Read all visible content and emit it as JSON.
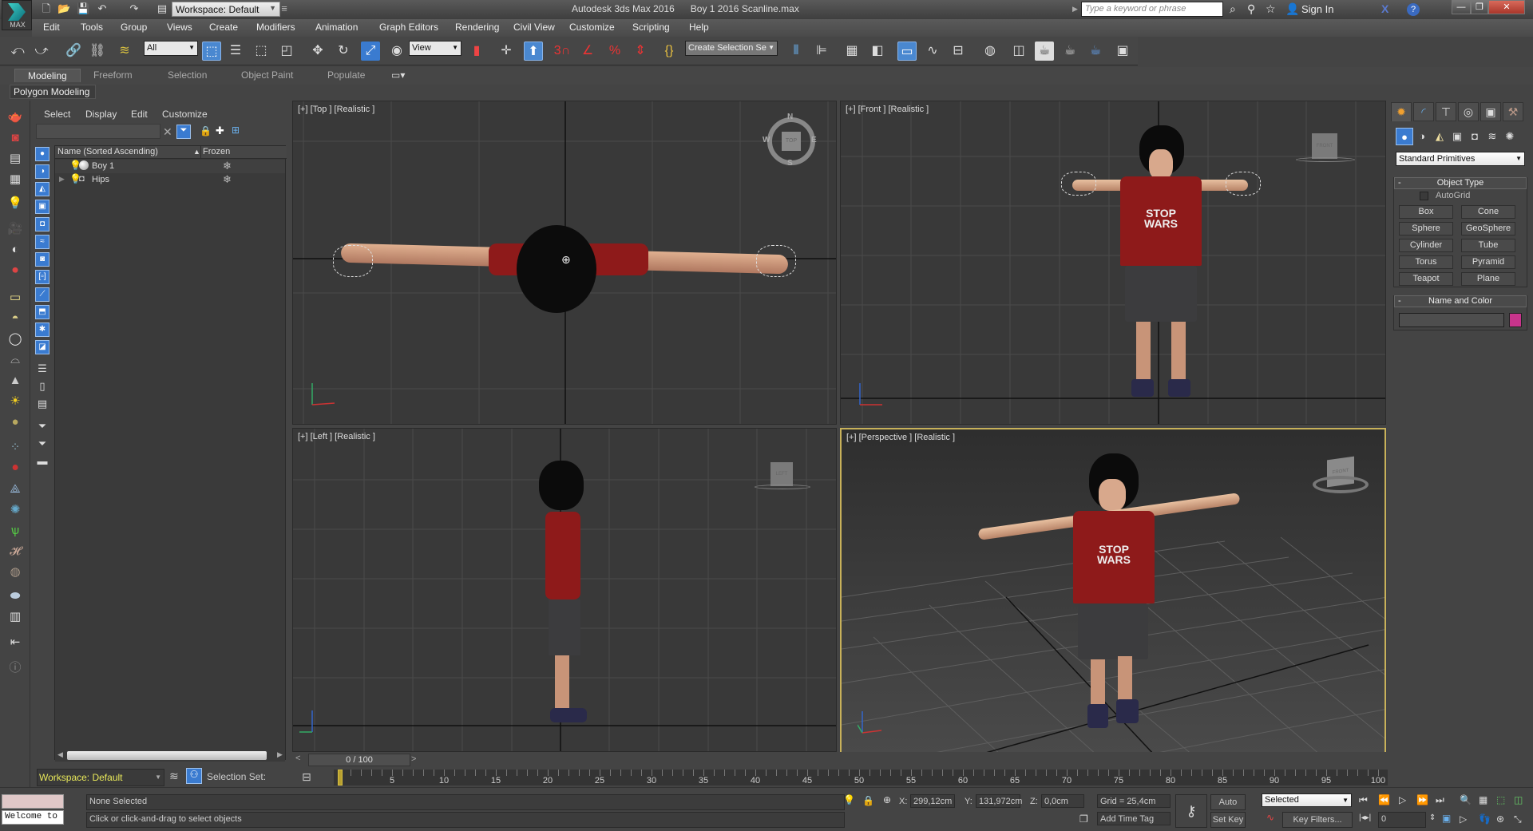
{
  "app": {
    "title": "Autodesk 3ds Max 2016",
    "file": "Boy 1 2016 Scanline.max",
    "logo_label": "MAX",
    "workspace": "Workspace: Default",
    "search_placeholder": "Type a keyword or phrase",
    "sign_in": "Sign In"
  },
  "menu": [
    "Edit",
    "Tools",
    "Group",
    "Views",
    "Create",
    "Modifiers",
    "Animation",
    "Graph Editors",
    "Rendering",
    "Civil View",
    "Customize",
    "Scripting",
    "Help"
  ],
  "toolbar": {
    "selection_filter": "All",
    "ref_coord": "View",
    "selection_set": "Create Selection Se",
    "snap_label": "3"
  },
  "ribbon": {
    "tabs": [
      "Modeling",
      "Freeform",
      "Selection",
      "Object Paint",
      "Populate"
    ],
    "active_tab": "Modeling",
    "panel": "Polygon Modeling"
  },
  "scene_explorer": {
    "menus": [
      "Select",
      "Display",
      "Edit",
      "Customize"
    ],
    "columns": [
      "Name (Sorted Ascending)",
      "Frozen"
    ],
    "rows": [
      {
        "name": "Boy 1",
        "frozen_icon": "snowflake-icon",
        "expandable": false
      },
      {
        "name": "Hips",
        "frozen_icon": "snowflake-icon",
        "expandable": true
      }
    ],
    "workspace": "Workspace: Default",
    "selection_set_label": "Selection Set:"
  },
  "viewports": [
    {
      "label": "[+] [Top ] [Realistic ]",
      "viewcube": "TOP",
      "compass": [
        "N",
        "E",
        "S",
        "W"
      ]
    },
    {
      "label": "[+] [Front ] [Realistic ]",
      "viewcube": "FRONT"
    },
    {
      "label": "[+] [Left ] [Realistic ]",
      "viewcube": "LEFT"
    },
    {
      "label": "[+] [Perspective ] [Realistic ]",
      "viewcube": "FRONT",
      "active": true
    }
  ],
  "shirt_text": [
    "STOP",
    "WARS"
  ],
  "command_panel": {
    "category": "Standard Primitives",
    "object_type_title": "Object Type",
    "autogrid": "AutoGrid",
    "autogrid_checked": false,
    "buttons": [
      "Box",
      "Cone",
      "Sphere",
      "GeoSphere",
      "Cylinder",
      "Tube",
      "Torus",
      "Pyramid",
      "Teapot",
      "Plane"
    ],
    "name_color_title": "Name and Color",
    "name_value": "",
    "object_color": "#c8348c"
  },
  "timeline": {
    "slider": "0 / 100",
    "current_frame": 0,
    "start": 0,
    "end": 100,
    "tick_labels": [
      "0",
      "5",
      "10",
      "15",
      "20",
      "25",
      "30",
      "35",
      "40",
      "45",
      "50",
      "55",
      "60",
      "65",
      "70",
      "75",
      "80",
      "85",
      "90",
      "95",
      "100"
    ]
  },
  "status": {
    "maxscript": "Welcome to M",
    "selection": "None Selected",
    "prompt": "Click or click-and-drag to select objects",
    "x_label": "X:",
    "x": "299,12cm",
    "y_label": "Y:",
    "y": "131,972cm",
    "z_label": "Z:",
    "z": "0,0cm",
    "grid": "Grid = 25,4cm",
    "add_time_tag": "Add Time Tag",
    "auto_key": "Auto Key",
    "set_key": "Set Key",
    "key_mode": "Selected",
    "key_filters": "Key Filters...",
    "frame": "0"
  },
  "colors": {
    "accent_blue": "#3a7bd0",
    "active_viewport_border": "#c8b15a",
    "shirt": "#8e1a1a",
    "workspace_text": "#e8e85a"
  }
}
